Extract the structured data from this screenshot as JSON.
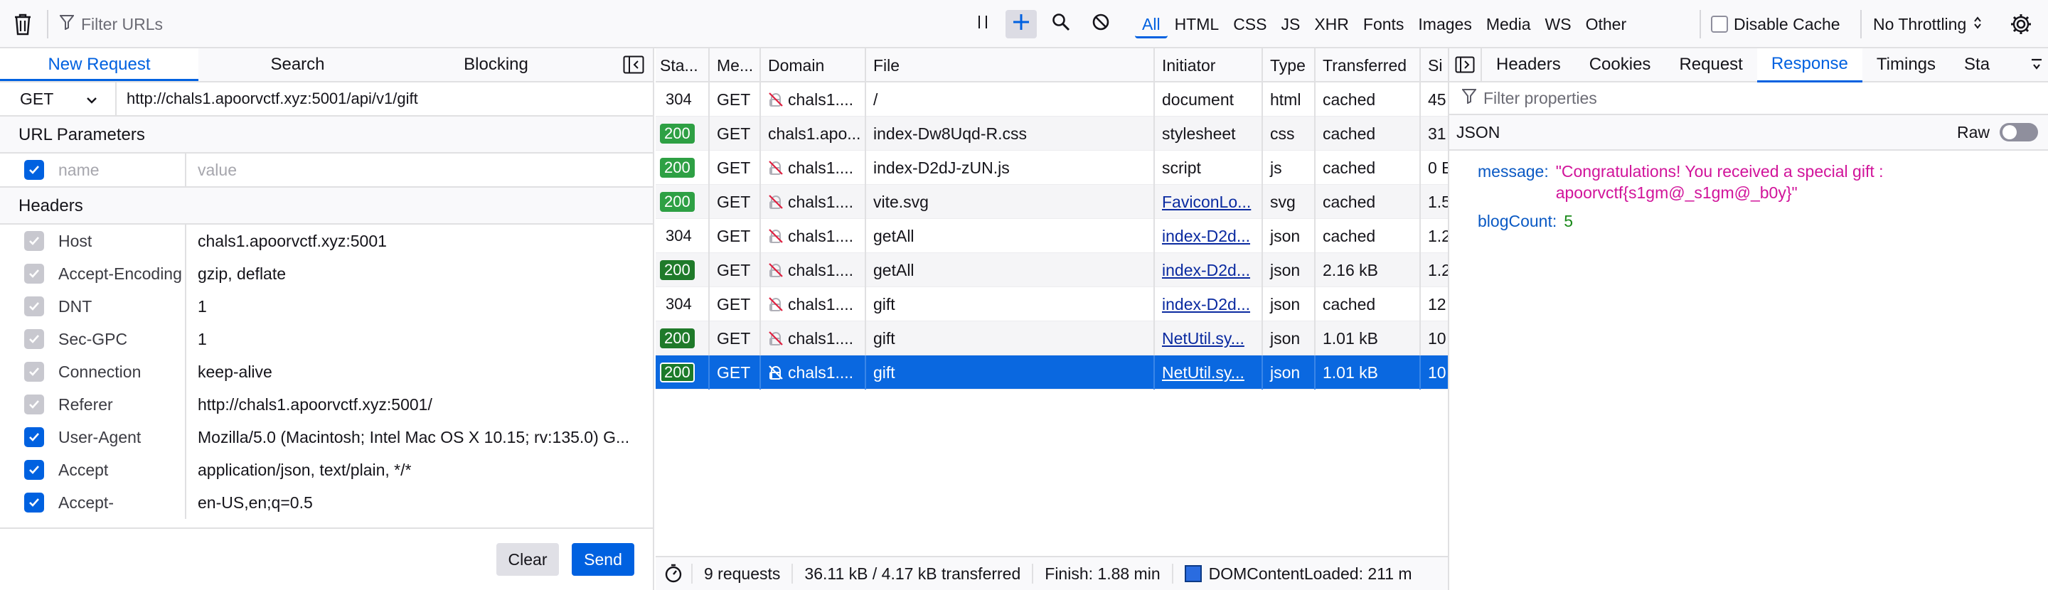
{
  "toolbar": {
    "filter_placeholder": "Filter URLs",
    "type_filters": [
      "All",
      "HTML",
      "CSS",
      "JS",
      "XHR",
      "Fonts",
      "Images",
      "Media",
      "WS",
      "Other"
    ],
    "active_filter": "All",
    "disable_cache_label": "Disable Cache",
    "throttling_label": "No Throttling"
  },
  "left": {
    "tabs": [
      "New Request",
      "Search",
      "Blocking"
    ],
    "active_tab": "New Request",
    "method": "GET",
    "url": "http://chals1.apoorvctf.xyz:5001/api/v1/gift",
    "url_params_title": "URL Parameters",
    "param_name_placeholder": "name",
    "param_value_placeholder": "value",
    "headers_title": "Headers",
    "headers": [
      {
        "name": "Host",
        "value": "chals1.apoorvctf.xyz:5001",
        "checked": false
      },
      {
        "name": "Accept-Encoding",
        "value": "gzip, deflate",
        "checked": false
      },
      {
        "name": "DNT",
        "value": "1",
        "checked": false
      },
      {
        "name": "Sec-GPC",
        "value": "1",
        "checked": false
      },
      {
        "name": "Connection",
        "value": "keep-alive",
        "checked": false
      },
      {
        "name": "Referer",
        "value": "http://chals1.apoorvctf.xyz:5001/",
        "checked": false
      },
      {
        "name": "User-Agent",
        "value": "Mozilla/5.0 (Macintosh; Intel Mac OS X 10.15; rv:135.0) G...",
        "checked": true
      },
      {
        "name": "Accept",
        "value": "application/json, text/plain, */*",
        "checked": true
      },
      {
        "name": "Accept-Language",
        "value": "en-US,en;q=0.5",
        "checked": true
      }
    ],
    "clear_label": "Clear",
    "send_label": "Send"
  },
  "table": {
    "columns": [
      "Sta...",
      "Me...",
      "Domain",
      "File",
      "Initiator",
      "Type",
      "Transferred",
      "Si"
    ],
    "rows": [
      {
        "status": "304",
        "method": "GET",
        "domain": "chals1....",
        "file": "/",
        "initiator": "document",
        "initiator_link": false,
        "type": "html",
        "transferred": "cached",
        "size": "45"
      },
      {
        "status": "200",
        "method": "GET",
        "domain": "chals1.apo...",
        "file": "index-Dw8Uqd-R.css",
        "initiator": "stylesheet",
        "initiator_link": false,
        "type": "css",
        "transferred": "cached",
        "size": "31"
      },
      {
        "status": "200",
        "method": "GET",
        "domain": "chals1....",
        "file": "index-D2dJ-zUN.js",
        "initiator": "script",
        "initiator_link": false,
        "type": "js",
        "transferred": "cached",
        "size": "0 E"
      },
      {
        "status": "200",
        "method": "GET",
        "domain": "chals1....",
        "file": "vite.svg",
        "initiator": "FaviconLo...",
        "initiator_link": true,
        "type": "svg",
        "transferred": "cached",
        "size": "1.5"
      },
      {
        "status": "304",
        "method": "GET",
        "domain": "chals1....",
        "file": "getAll",
        "initiator": "index-D2d...",
        "initiator_link": true,
        "type": "json",
        "transferred": "cached",
        "size": "1.2"
      },
      {
        "status": "200",
        "method": "GET",
        "domain": "chals1....",
        "file": "getAll",
        "initiator": "index-D2d...",
        "initiator_link": true,
        "type": "json",
        "transferred": "2.16 kB",
        "size": "1.2"
      },
      {
        "status": "304",
        "method": "GET",
        "domain": "chals1....",
        "file": "gift",
        "initiator": "index-D2d...",
        "initiator_link": true,
        "type": "json",
        "transferred": "cached",
        "size": "12"
      },
      {
        "status": "200",
        "method": "GET",
        "domain": "chals1....",
        "file": "gift",
        "initiator": "NetUtil.sy...",
        "initiator_link": true,
        "type": "json",
        "transferred": "1.01 kB",
        "size": "10"
      },
      {
        "status": "200",
        "method": "GET",
        "domain": "chals1....",
        "file": "gift",
        "initiator": "NetUtil.sy...",
        "initiator_link": true,
        "type": "json",
        "transferred": "1.01 kB",
        "size": "10"
      }
    ],
    "selected_row": 8
  },
  "status_bar": {
    "requests": "9 requests",
    "size": "36.11 kB / 4.17 kB transferred",
    "finish": "Finish: 1.88 min",
    "dcl": "DOMContentLoaded: 211 m"
  },
  "right": {
    "tabs": [
      "Headers",
      "Cookies",
      "Request",
      "Response",
      "Timings",
      "Sta"
    ],
    "active_tab": "Response",
    "filter_placeholder": "Filter properties",
    "json_label": "JSON",
    "raw_label": "Raw",
    "json": {
      "message_key": "message:",
      "message_value": "\"Congratulations! You received a special gift : apoorvctf{s1gm@_s1gm@_b0y}\"",
      "blog_key": "blogCount:",
      "blog_value": "5"
    }
  },
  "colors": {
    "accent": "#0061e0",
    "selected_row": "#0a68e0",
    "status_ok": "#2ea044",
    "json_string": "#d1139a",
    "json_key": "#0a59c4"
  }
}
